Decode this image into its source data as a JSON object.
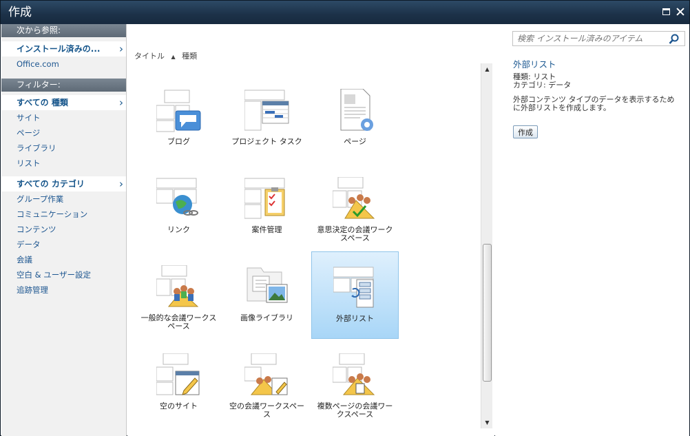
{
  "window": {
    "title": "作成"
  },
  "sidebar": {
    "browse_header": "次から参照:",
    "browse_selected": "インストール済みの...",
    "browse_items": [
      "Office.com"
    ],
    "filter_header": "フィルター:",
    "type_selected": "すべての 種類",
    "type_items": [
      "サイト",
      "ページ",
      "ライブラリ",
      "リスト"
    ],
    "category_selected": "すべての カテゴリ",
    "category_items": [
      "グループ作業",
      "コミュニケーション",
      "コンテンツ",
      "データ",
      "会議",
      "空白 & ユーザー設定",
      "追跡管理"
    ]
  },
  "sort": {
    "title": "タイトル",
    "type": "種類"
  },
  "tiles": [
    {
      "label": "ブログ"
    },
    {
      "label": "プロジェクト タスク"
    },
    {
      "label": "ページ"
    },
    {
      "label": "リンク"
    },
    {
      "label": "案件管理"
    },
    {
      "label": "意思決定の会議ワークスペース"
    },
    {
      "label": "一般的な会議ワークスペース"
    },
    {
      "label": "画像ライブラリ"
    },
    {
      "label": "外部リスト"
    },
    {
      "label": "空のサイト"
    },
    {
      "label": "空の会議ワークスペース"
    },
    {
      "label": "複数ページの会議ワークスペース"
    }
  ],
  "selected_tile": "外部リスト",
  "search": {
    "placeholder": "検索 インストール済みのアイテム"
  },
  "detail": {
    "title": "外部リスト",
    "type": "種類: リスト",
    "category": "カテゴリ: データ",
    "description": "外部コンテンツ タイプのデータを表示するために外部リストを作成します。",
    "create_label": "作成"
  },
  "colors": {
    "titlebar": "#1c3148",
    "link": "#1d5690",
    "selection": "#a8d6f7"
  }
}
